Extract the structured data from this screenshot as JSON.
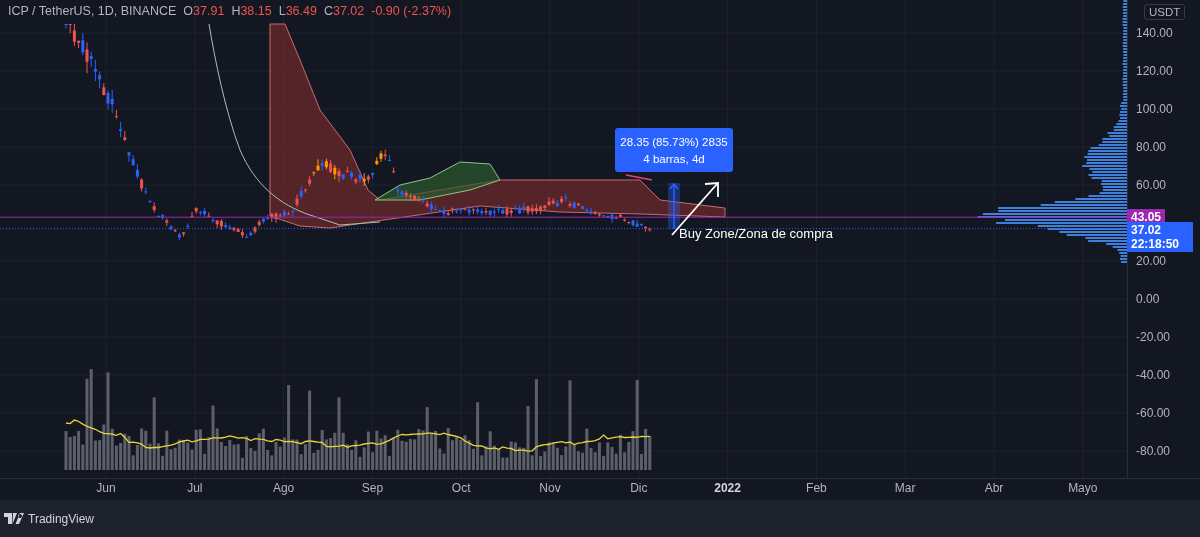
{
  "header": {
    "symbol": "ICP / TetherUS, 1D, BINANCE",
    "ohlc": [
      {
        "label": "O",
        "value": "37.91"
      },
      {
        "label": "H",
        "value": "38.15"
      },
      {
        "label": "L",
        "value": "36.49"
      },
      {
        "label": "C",
        "value": "37.02"
      }
    ],
    "change": "-0.90 (-2.37%)"
  },
  "price_axis": {
    "currency": "USDT",
    "ticks": [
      "140.00",
      "120.00",
      "100.00",
      "80.00",
      "60.00",
      "20.00",
      "0.00",
      "-20.00",
      "-40.00",
      "-60.00",
      "-80.00"
    ],
    "markers": [
      {
        "kind": "level",
        "value": "43.05",
        "color": "#9c27b0"
      },
      {
        "kind": "last",
        "value": "37.02",
        "countdown": "22:18:50",
        "color": "#2962ff"
      }
    ]
  },
  "measure_label": {
    "lines": [
      "28.35 (85.73%) 2835",
      "4 barras, 4d"
    ]
  },
  "annotation": "Buy Zone/Zona de compra",
  "time_axis": [
    {
      "label": "Jun",
      "bold": false
    },
    {
      "label": "Jul",
      "bold": false
    },
    {
      "label": "Ago",
      "bold": false
    },
    {
      "label": "Sep",
      "bold": false
    },
    {
      "label": "Oct",
      "bold": false
    },
    {
      "label": "Nov",
      "bold": false
    },
    {
      "label": "Dic",
      "bold": false
    },
    {
      "label": "2022",
      "bold": true
    },
    {
      "label": "Feb",
      "bold": false
    },
    {
      "label": "Mar",
      "bold": false
    },
    {
      "label": "Abr",
      "bold": false
    },
    {
      "label": "Mayo",
      "bold": false
    }
  ],
  "footer": {
    "brand": "TradingView"
  }
}
